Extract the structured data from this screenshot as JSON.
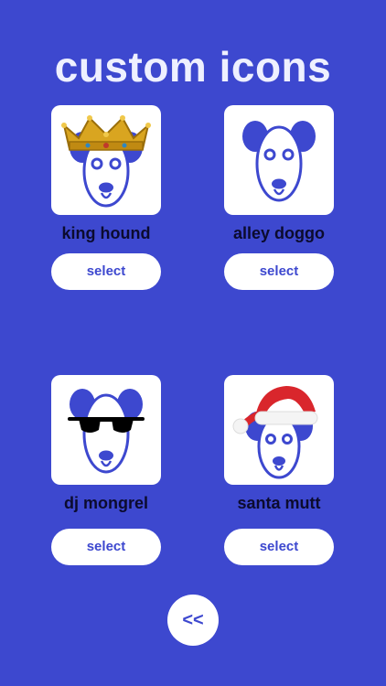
{
  "title": "custom icons",
  "colors": {
    "background": "#3d48cf",
    "accent": "#3d48cf",
    "tile": "#ffffff",
    "label": "#0b0b2e"
  },
  "icons": [
    {
      "name": "king hound",
      "accessory": "crown-icon",
      "select_label": "select"
    },
    {
      "name": "alley doggo",
      "accessory": "none",
      "select_label": "select"
    },
    {
      "name": "dj mongrel",
      "accessory": "sunglasses-icon",
      "select_label": "select"
    },
    {
      "name": "santa mutt",
      "accessory": "santa-hat-icon",
      "select_label": "select"
    }
  ],
  "back_label": "<<"
}
